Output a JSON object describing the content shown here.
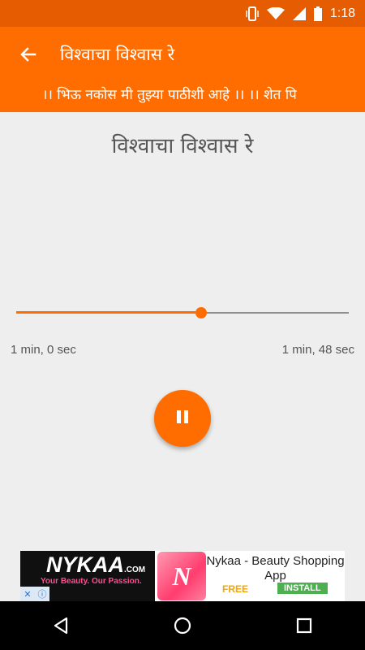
{
  "status_bar": {
    "time": "1:18",
    "icons": [
      "vibrate-icon",
      "wifi-icon",
      "signal-icon",
      "battery-icon"
    ]
  },
  "app_bar": {
    "title": "विश्वाचा विश्वास रे",
    "back_icon": "arrow-left-icon"
  },
  "ticker": {
    "text": "।। भिऊ नकोस मी तुझ्या पाठीशी आहे ।। ।। शेत पि"
  },
  "player": {
    "song_title": "विश्वाचा विश्वास रे",
    "elapsed": "1 min, 0 sec",
    "total": "1 min, 48 sec",
    "progress_fraction": 0.556,
    "state_icon": "pause-icon"
  },
  "ad": {
    "brand_logo": "NYKAA",
    "brand_domain": ".COM",
    "brand_tagline": "Your Beauty. Our Passion.",
    "app_icon_letter": "N",
    "app_name": "Nykaa - Beauty Shopping App",
    "price": "FREE",
    "install_label": "INSTALL"
  },
  "nav_bar": {
    "buttons": [
      "back-triangle-icon",
      "home-circle-icon",
      "recents-square-icon"
    ]
  },
  "colors": {
    "accent": "#ff6d00",
    "status_bar": "#e65c00",
    "background": "#eeeeee"
  }
}
